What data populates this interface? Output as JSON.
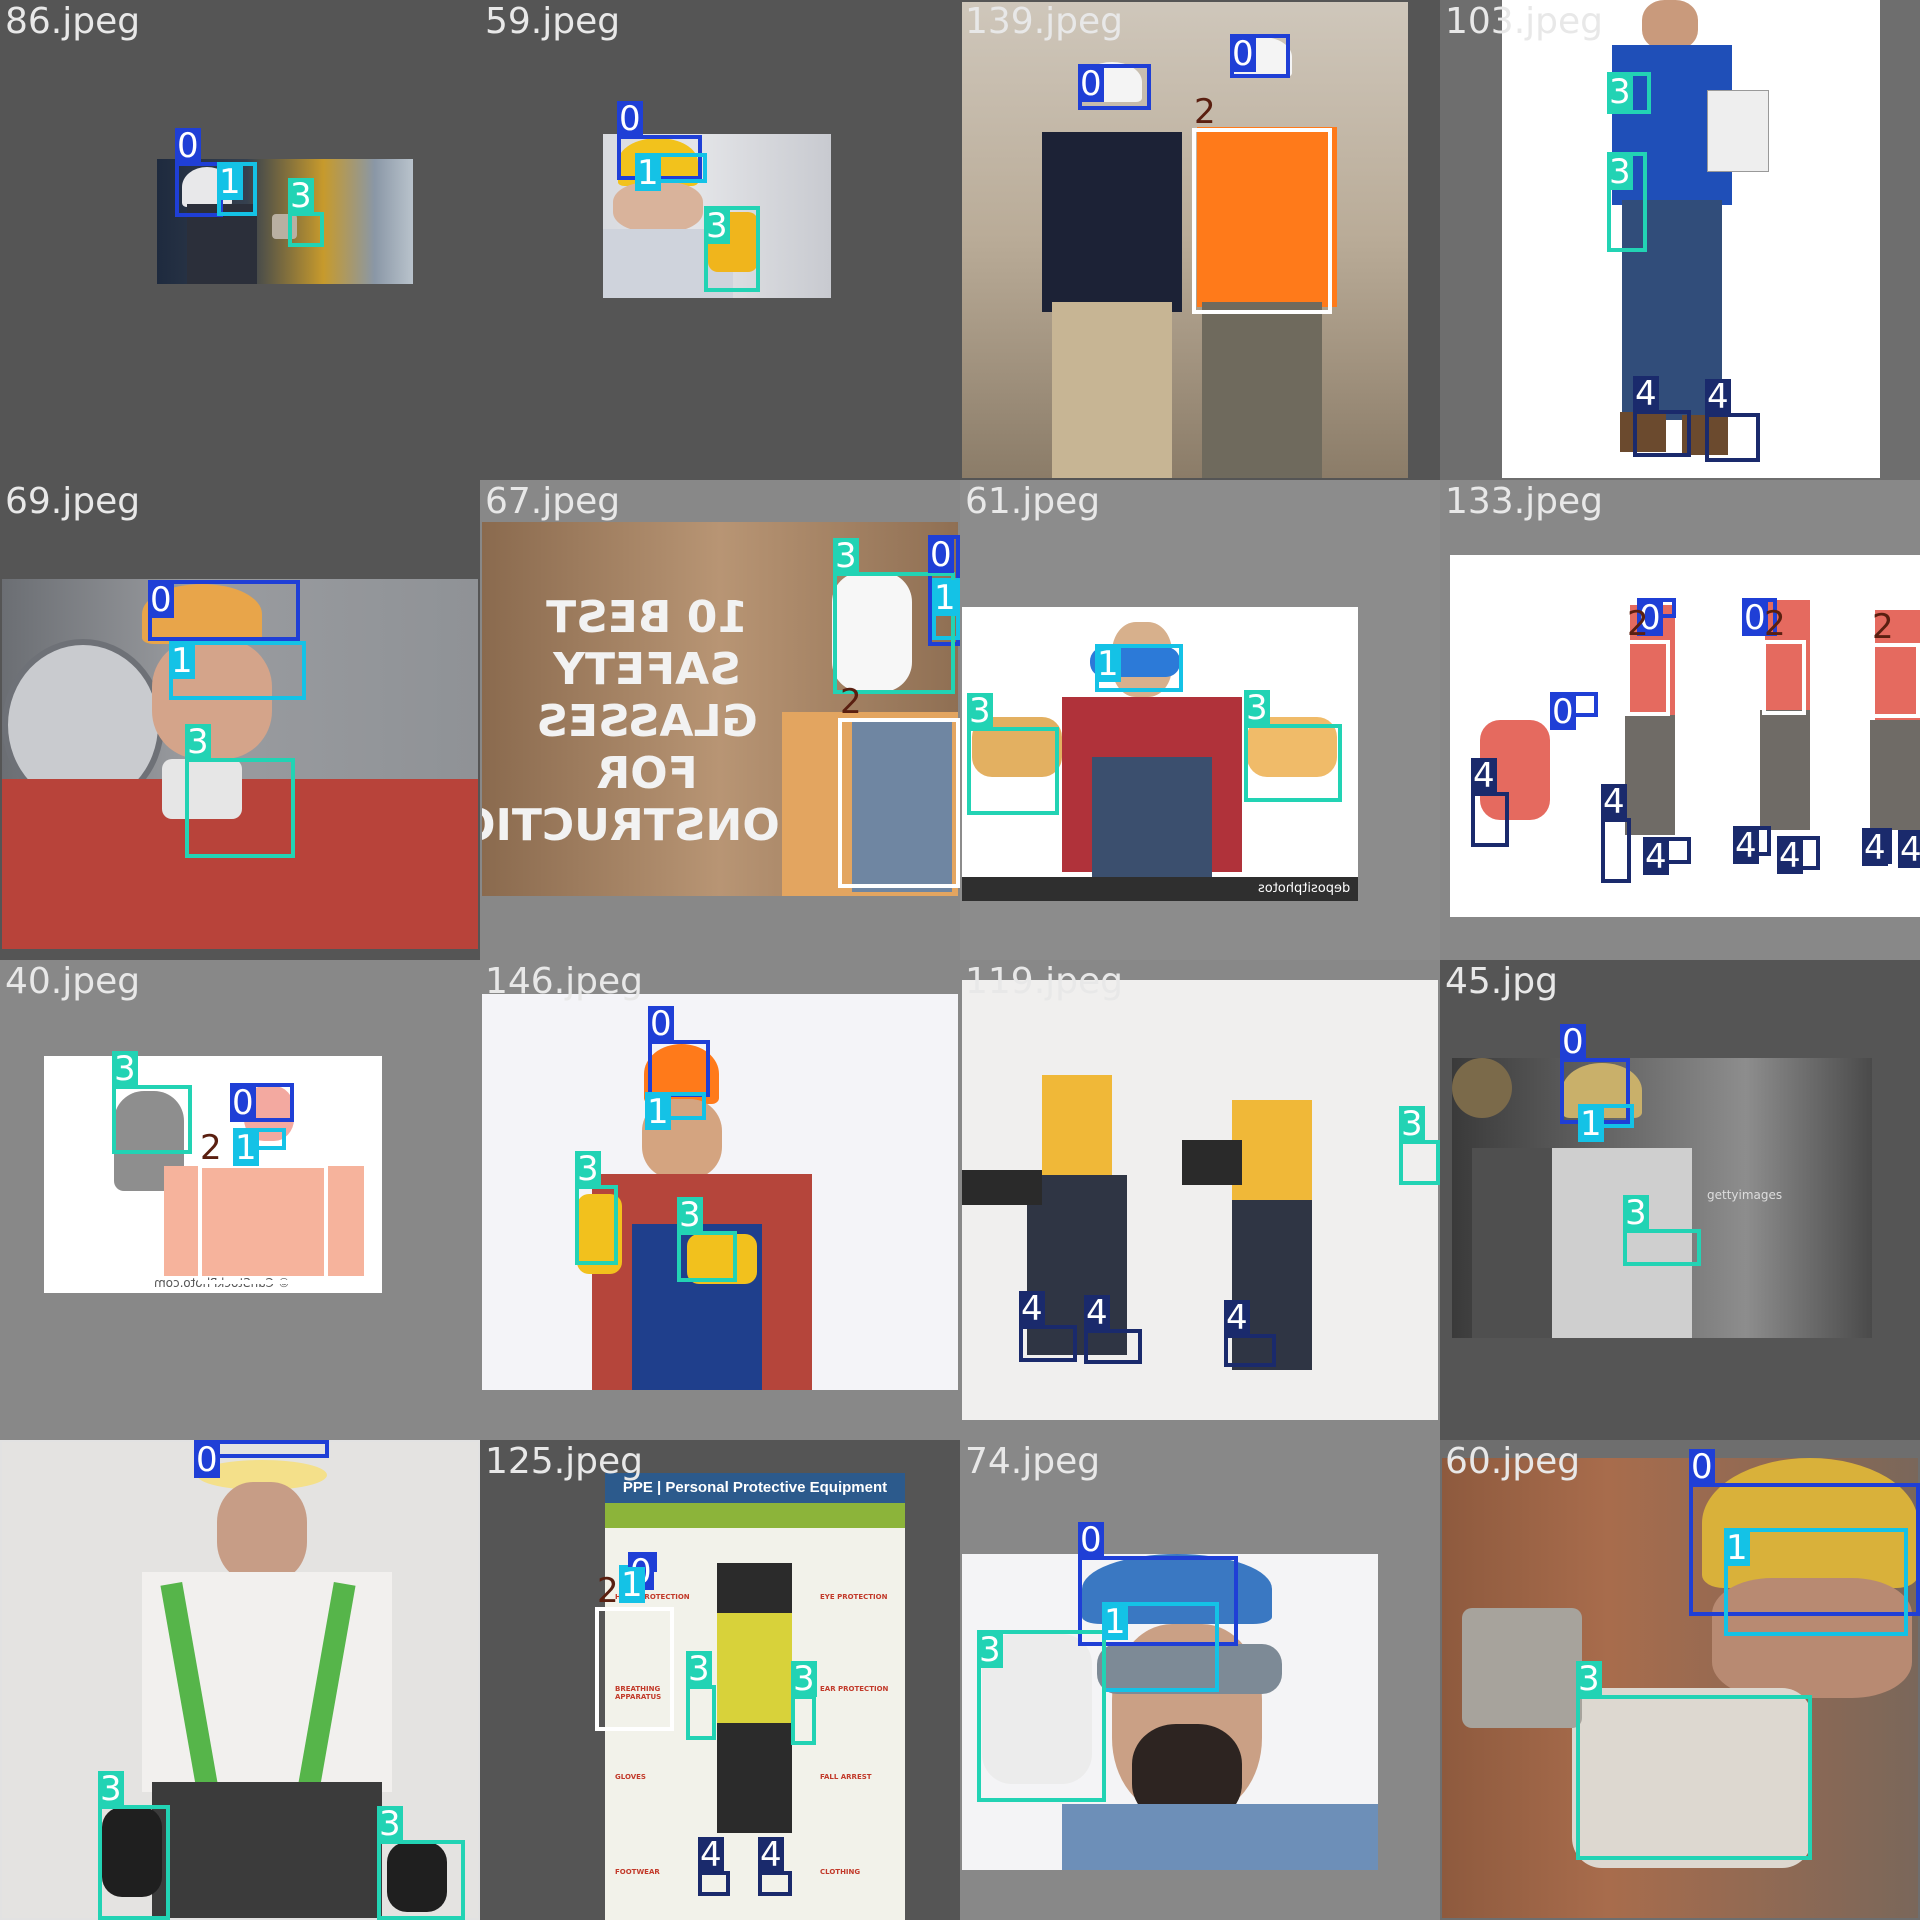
{
  "classes": {
    "0": {
      "name": "0",
      "color": "#1f3fd6"
    },
    "1": {
      "name": "1",
      "color": "#14c2e6"
    },
    "2": {
      "name": "2",
      "color": "#ffffff",
      "text_color": "#5a1f10"
    },
    "3": {
      "name": "3",
      "color": "#22d3b4"
    },
    "4": {
      "name": "4",
      "color": "#1a2a6c"
    }
  },
  "tiles": [
    {
      "filename": "86.jpeg",
      "labels": [
        "0",
        "1",
        "3"
      ]
    },
    {
      "filename": "59.jpeg",
      "labels": [
        "0",
        "1",
        "3"
      ]
    },
    {
      "filename": "139.jpeg",
      "labels": [
        "0",
        "0",
        "2"
      ]
    },
    {
      "filename": "103.jpeg",
      "labels": [
        "3",
        "3",
        "4",
        "4"
      ]
    },
    {
      "filename": "69.jpeg",
      "labels": [
        "0",
        "1",
        "3"
      ]
    },
    {
      "filename": "67.jpeg",
      "labels": [
        "0",
        "1",
        "3",
        "2"
      ]
    },
    {
      "filename": "61.jpeg",
      "labels": [
        "1",
        "3",
        "3"
      ]
    },
    {
      "filename": "133.jpeg",
      "labels": [
        "0",
        "0",
        "0",
        "2",
        "2",
        "2",
        "4",
        "4",
        "4",
        "4",
        "4",
        "4",
        "4"
      ]
    },
    {
      "filename": "40.jpeg",
      "labels": [
        "3",
        "0",
        "1",
        "2"
      ]
    },
    {
      "filename": "146.jpeg",
      "labels": [
        "0",
        "1",
        "3",
        "3"
      ]
    },
    {
      "filename": "119.jpeg",
      "labels": [
        "3",
        "4",
        "4",
        "4"
      ]
    },
    {
      "filename": "45.jpg",
      "labels": [
        "0",
        "1",
        "3"
      ]
    },
    {
      "filename": "",
      "labels": [
        "0",
        "3",
        "3"
      ]
    },
    {
      "filename": "125.jpeg",
      "labels": [
        "0",
        "1",
        "2",
        "3",
        "3",
        "4",
        "4"
      ]
    },
    {
      "filename": "74.jpeg",
      "labels": [
        "0",
        "1",
        "3"
      ]
    },
    {
      "filename": "60.jpeg",
      "labels": [
        "0",
        "1",
        "3"
      ]
    }
  ],
  "poster_125": {
    "title": "PPE | Personal Protective Equipment",
    "items": [
      "HEAD PROTECTION",
      "EYE PROTECTION",
      "BREATHING APPARATUS",
      "EAR PROTECTION",
      "GLOVES",
      "FALL ARREST",
      "FOOTWEAR",
      "CLOTHING"
    ]
  },
  "sign_67": {
    "lines": [
      "10 BEST",
      "SAFETY",
      "GLASSES",
      "FOR",
      "CONSTRUCTIO"
    ]
  },
  "watermarks": {
    "t40": "© CanStockPhoto.com",
    "t45": "gettyimages",
    "t61": "depositphotos"
  }
}
